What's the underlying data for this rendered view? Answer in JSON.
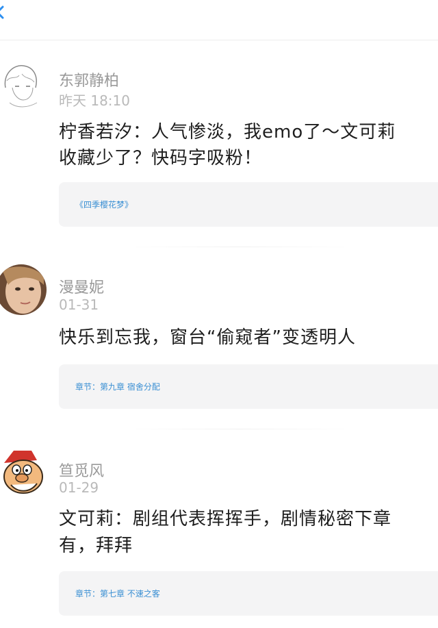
{
  "comments": [
    {
      "name": "东郭静柏",
      "time": "昨天 18:10",
      "body_lines": [
        "柠香若汐：人气惨淡，我emo了～文可莉",
        "收藏少了？快码字吸粉！"
      ],
      "ref": "《四季樱花梦》"
    },
    {
      "name": "漫曼妮",
      "time": "01-31",
      "body_lines": [
        "快乐到忘我，窗台“偷窥者”变透明人"
      ],
      "ref": "章节：第九章  宿舍分配"
    },
    {
      "name": "笪觅风",
      "time": "01-29",
      "body_lines": [
        "文可莉：剧组代表挥挥手，剧情秘密下章",
        "有，拜拜"
      ],
      "ref": "章节：第七章  不速之客"
    }
  ],
  "colors": {
    "accent_blue": "#3a8fd3",
    "name_gray": "#9a9a9a",
    "time_gray": "#b9b9b9",
    "body_text": "#1e1e1e",
    "card_bg": "#f4f4f5"
  }
}
